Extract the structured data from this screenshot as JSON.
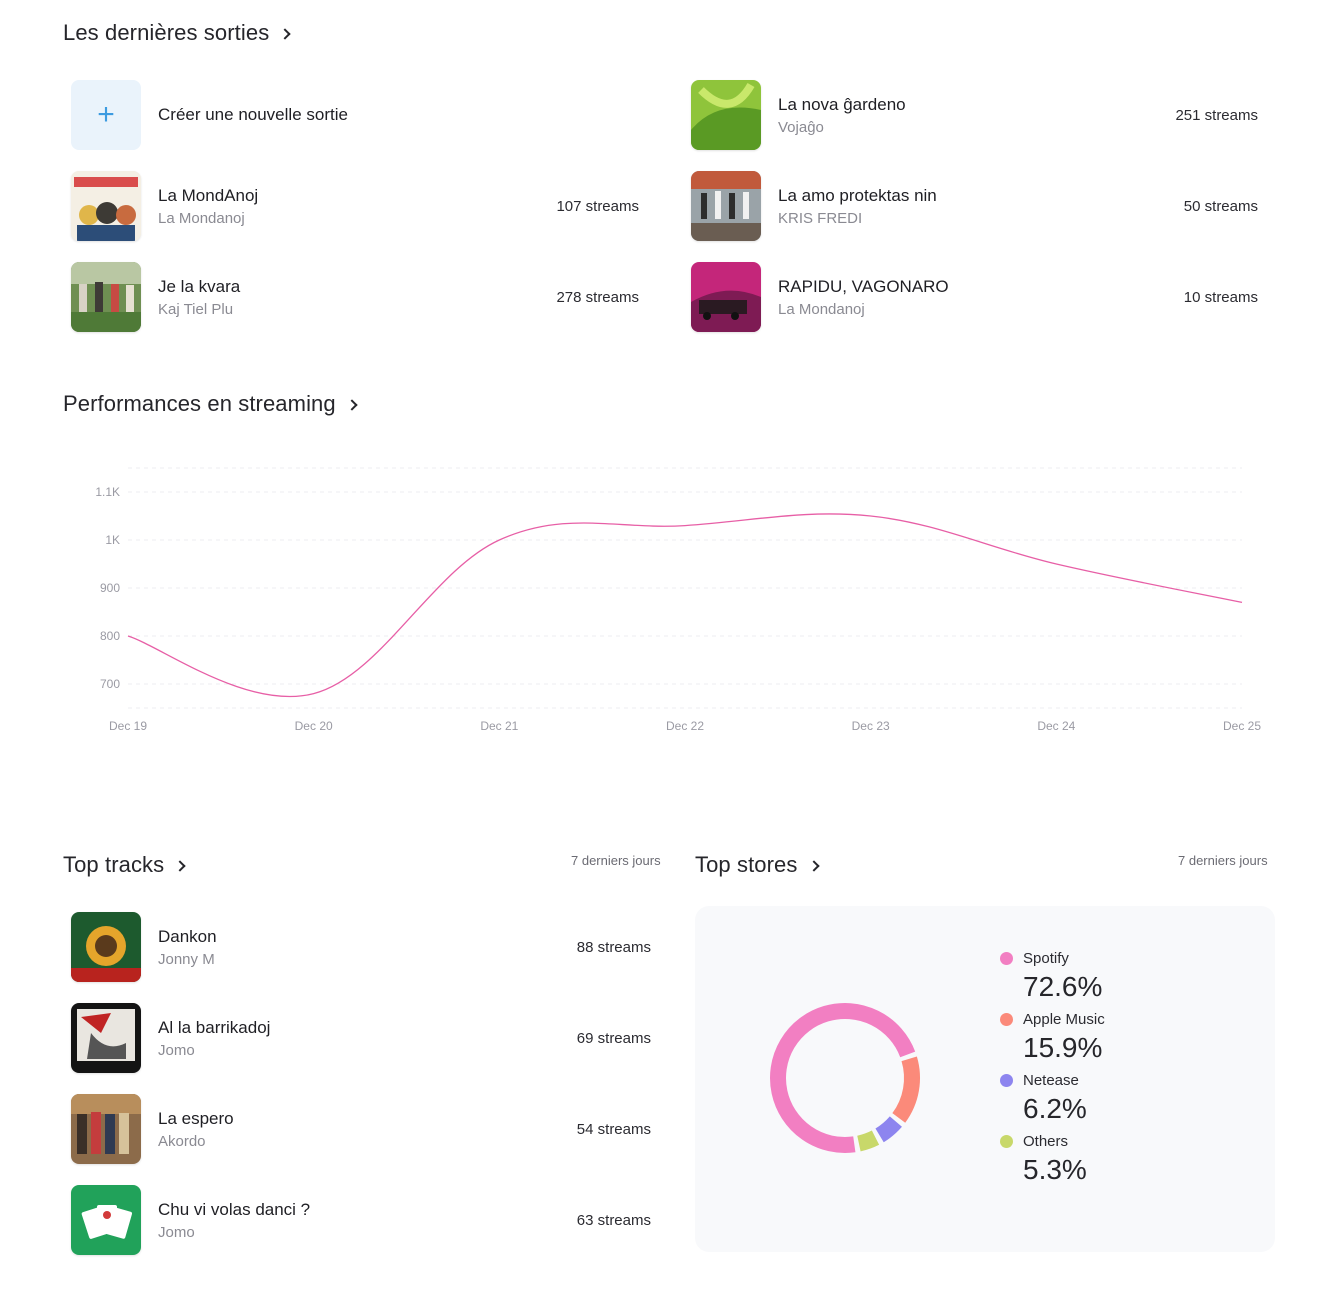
{
  "releases": {
    "title": "Les dernières sorties",
    "create_label": "Créer une nouvelle sortie",
    "left": [
      {
        "title": "La MondAnoj",
        "artist": "La Mondanoj",
        "streams": "107 streams"
      },
      {
        "title": "Je la kvara",
        "artist": "Kaj Tiel Plu",
        "streams": "278 streams"
      }
    ],
    "right": [
      {
        "title": "La nova ĝardeno",
        "artist": "Vojaĝo",
        "streams": "251 streams"
      },
      {
        "title": "La amo protektas nin",
        "artist": "KRIS FREDI",
        "streams": "50 streams"
      },
      {
        "title": "RAPIDU, VAGONARO",
        "artist": "La Mondanoj",
        "streams": "10 streams"
      }
    ]
  },
  "performance": {
    "title": "Performances en streaming"
  },
  "chart_data": {
    "type": "line",
    "x": [
      "Dec 19",
      "Dec 20",
      "Dec 21",
      "Dec 22",
      "Dec 23",
      "Dec 24",
      "Dec 25"
    ],
    "series": [
      {
        "values": [
          800,
          680,
          1000,
          1030,
          1050,
          950,
          870
        ],
        "color": "#e75fa6"
      }
    ],
    "yticks": [
      "700",
      "800",
      "900",
      "1K",
      "1.1K"
    ],
    "ylim": [
      650,
      1150
    ],
    "grid": true
  },
  "top_tracks": {
    "title": "Top tracks",
    "period": "7 derniers jours",
    "items": [
      {
        "title": "Dankon",
        "artist": "Jonny M",
        "streams": "88 streams"
      },
      {
        "title": "Al la barrikadoj",
        "artist": "Jomo",
        "streams": "69 streams"
      },
      {
        "title": "La espero",
        "artist": "Akordo",
        "streams": "54 streams"
      },
      {
        "title": "Chu vi volas danci ?",
        "artist": "Jomo",
        "streams": "63 streams"
      }
    ]
  },
  "top_stores": {
    "title": "Top stores",
    "period": "7 derniers jours",
    "items": [
      {
        "name": "Spotify",
        "value": "72.6%",
        "share": 72.6,
        "color": "#f27fc2"
      },
      {
        "name": "Apple Music",
        "value": "15.9%",
        "share": 15.9,
        "color": "#fb8a7a"
      },
      {
        "name": "Netease",
        "value": "6.2%",
        "share": 6.2,
        "color": "#8d85ef"
      },
      {
        "name": "Others",
        "value": "5.3%",
        "share": 5.3,
        "color": "#c8d86a"
      }
    ]
  }
}
